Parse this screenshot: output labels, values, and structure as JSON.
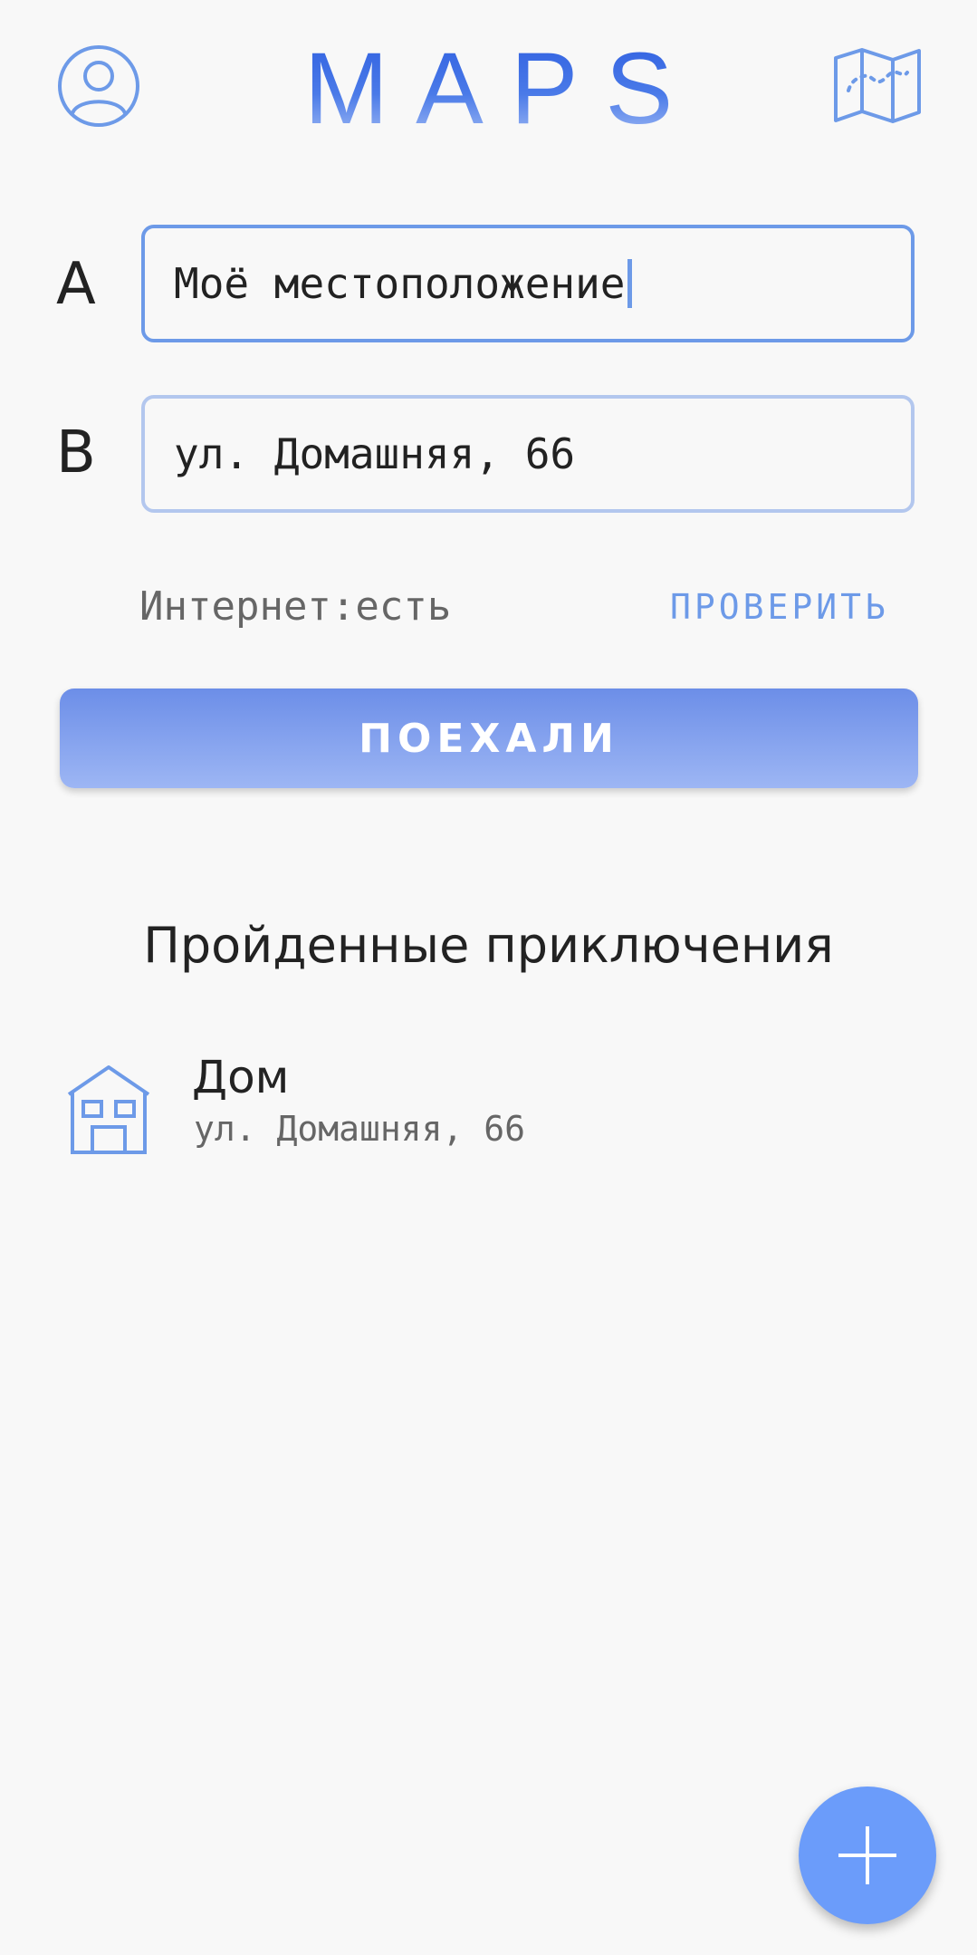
{
  "header": {
    "title": "MAPS"
  },
  "route": {
    "from_label": "A",
    "from_value": "Моё местоположение",
    "to_label": "B",
    "to_value": "ул. Домашняя, 66"
  },
  "status": {
    "internet_text": "Интернет:есть",
    "check_label": "ПРОВЕРИТЬ"
  },
  "actions": {
    "go_label": "ПОЕХАЛИ"
  },
  "history": {
    "title": "Пройденные приключения",
    "items": [
      {
        "name": "Дом",
        "address": "ул. Домашняя, 66",
        "icon": "house-icon"
      }
    ]
  },
  "icons": {
    "profile": "profile-icon",
    "map": "map-icon",
    "add": "plus-icon"
  },
  "colors": {
    "accent": "#6d9ae8",
    "fab": "#6b9cfa",
    "background": "#f8f8f8"
  }
}
